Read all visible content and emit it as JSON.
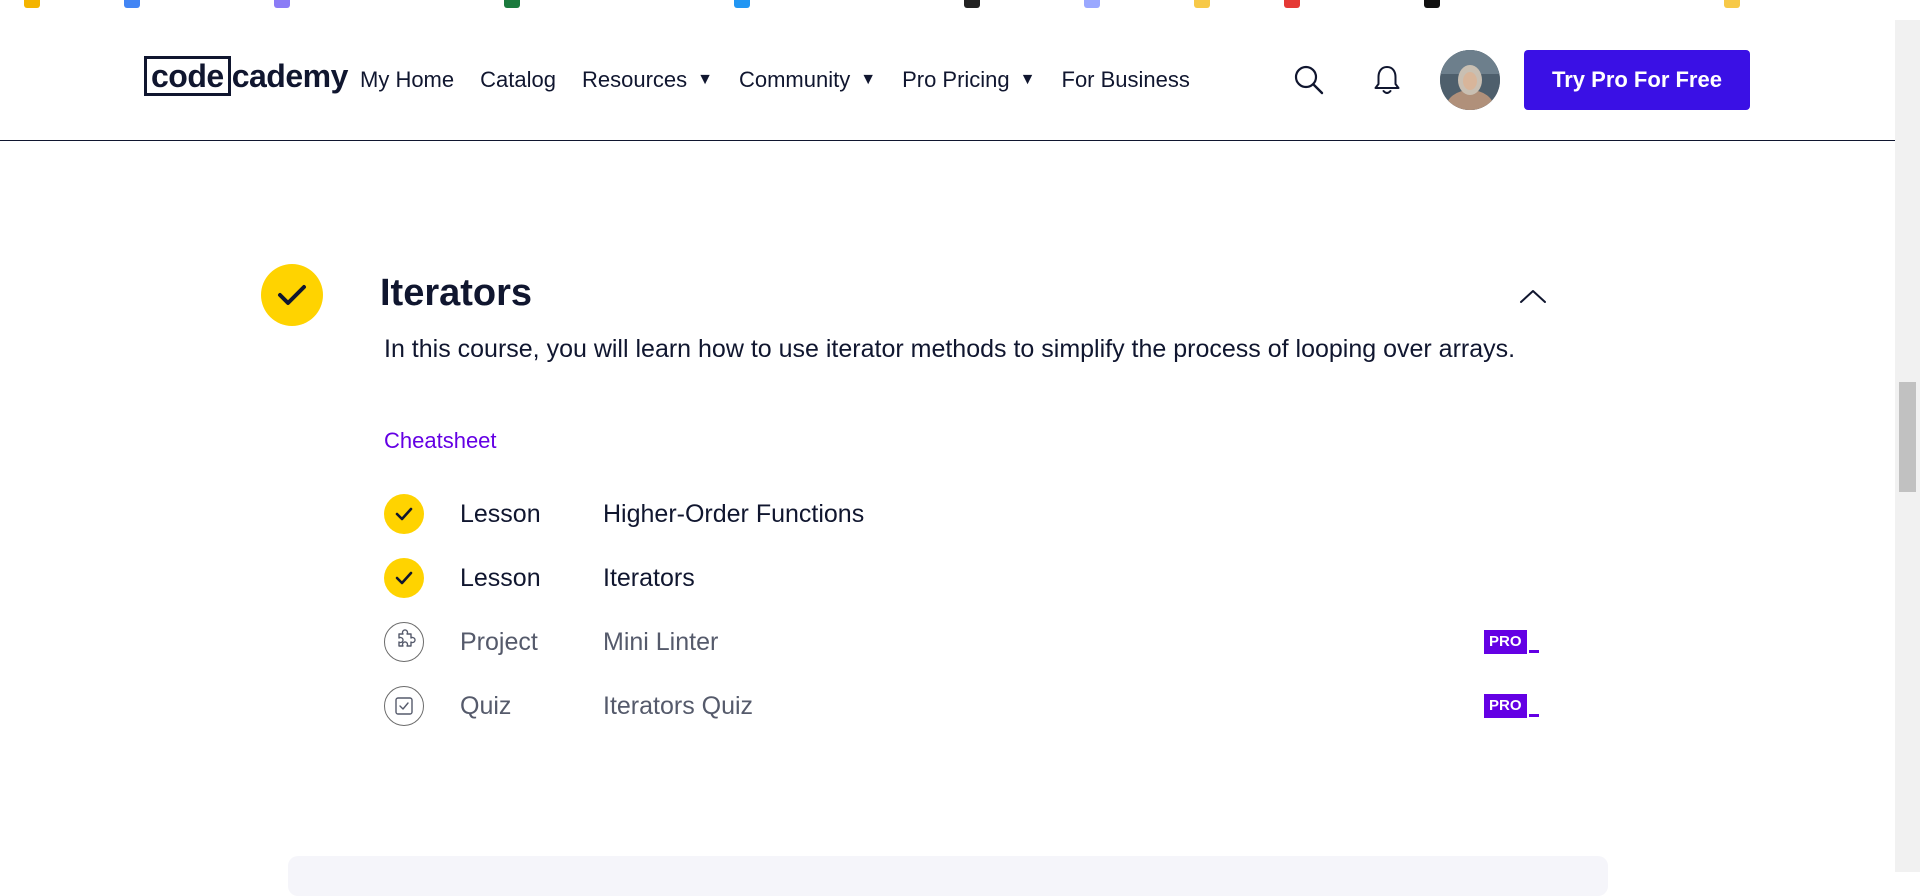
{
  "header": {
    "logo_code": "code",
    "logo_rest": "cademy",
    "nav": [
      {
        "label": "My Home",
        "dropdown": false
      },
      {
        "label": "Catalog",
        "dropdown": false
      },
      {
        "label": "Resources",
        "dropdown": true
      },
      {
        "label": "Community",
        "dropdown": true
      },
      {
        "label": "Pro Pricing",
        "dropdown": true
      },
      {
        "label": "For Business",
        "dropdown": false
      }
    ],
    "caret": "▼",
    "search_icon": "search-icon",
    "bell_icon": "bell-icon",
    "cta_label": "Try Pro For Free"
  },
  "module": {
    "title": "Iterators",
    "completed": true,
    "description": "In this course, you will learn how to use iterator methods to simplify the process of looping over arrays.",
    "cheatsheet_label": "Cheatsheet",
    "items": [
      {
        "type": "Lesson",
        "name": "Higher-Order Functions",
        "completed": true,
        "pro": false
      },
      {
        "type": "Lesson",
        "name": "Iterators",
        "completed": true,
        "pro": false
      },
      {
        "type": "Project",
        "name": "Mini Linter",
        "completed": false,
        "pro": true,
        "icon": "puzzle-icon"
      },
      {
        "type": "Quiz",
        "name": "Iterators Quiz",
        "completed": false,
        "pro": true,
        "icon": "quiz-icon"
      }
    ],
    "pro_label": "PRO"
  },
  "colors": {
    "accent": "#3a10e5",
    "pro_purple": "#6400e4",
    "check_yellow": "#ffd300",
    "text": "#10162f"
  }
}
